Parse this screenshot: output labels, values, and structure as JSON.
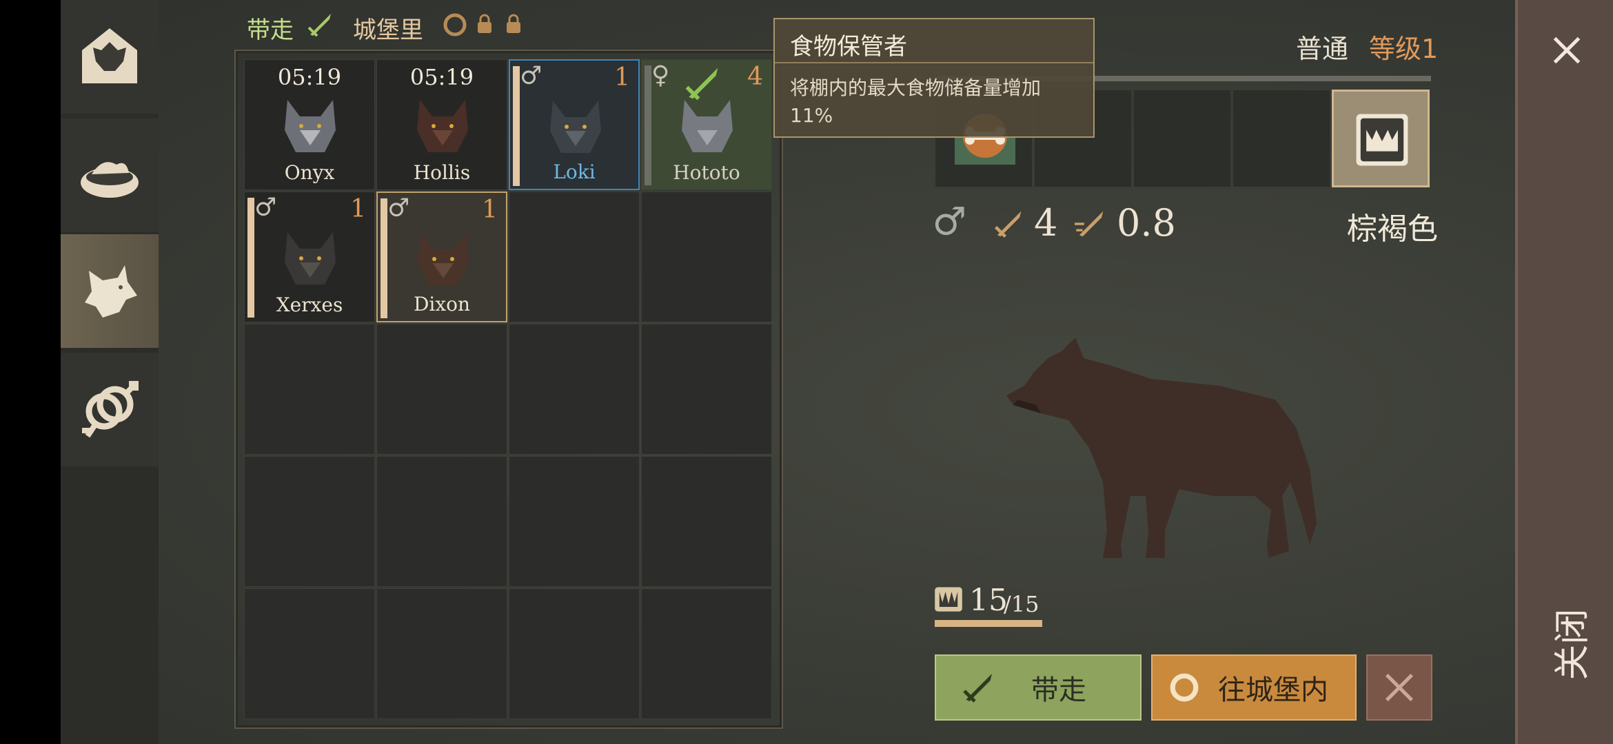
{
  "header": {
    "take_label": "带走",
    "castle_label": "城堡里"
  },
  "sidebar": {
    "items": [
      {
        "name": "wolf-house-icon"
      },
      {
        "name": "food-bowl-icon"
      },
      {
        "name": "wolf-icon"
      },
      {
        "name": "breeding-icon"
      }
    ],
    "active_index": 2
  },
  "wolves": [
    {
      "name": "Onyx",
      "timer": "05:19",
      "gender": "",
      "level": ""
    },
    {
      "name": "Hollis",
      "timer": "05:19",
      "gender": "",
      "level": ""
    },
    {
      "name": "Loki",
      "timer": "",
      "gender": "♂",
      "level": "1"
    },
    {
      "name": "Hototo",
      "timer": "",
      "gender": "♀",
      "level": "4"
    },
    {
      "name": "Xerxes",
      "timer": "",
      "gender": "♂",
      "level": "1"
    },
    {
      "name": "Dixon",
      "timer": "",
      "gender": "♂",
      "level": "1"
    }
  ],
  "tooltip": {
    "title": "食物保管者",
    "body": "将棚内的最大食物储备量增加11%"
  },
  "detail": {
    "rarity": "普通",
    "level_label": "等级1",
    "gender_symbol": "♂",
    "attack": "4",
    "speed": "0.8",
    "color_name": "棕褐色",
    "stamina": "15",
    "stamina_max": "/15",
    "stamina_fraction": 1.0
  },
  "actions": {
    "take_label": "带走",
    "to_castle_label": "往城堡内"
  },
  "close_label": "关闭",
  "colors": {
    "accent_gold": "#e19a5a",
    "take_green": "#8ea35e",
    "castle_orange": "#c98a3e",
    "loki_blue": "#6fb7e3"
  }
}
